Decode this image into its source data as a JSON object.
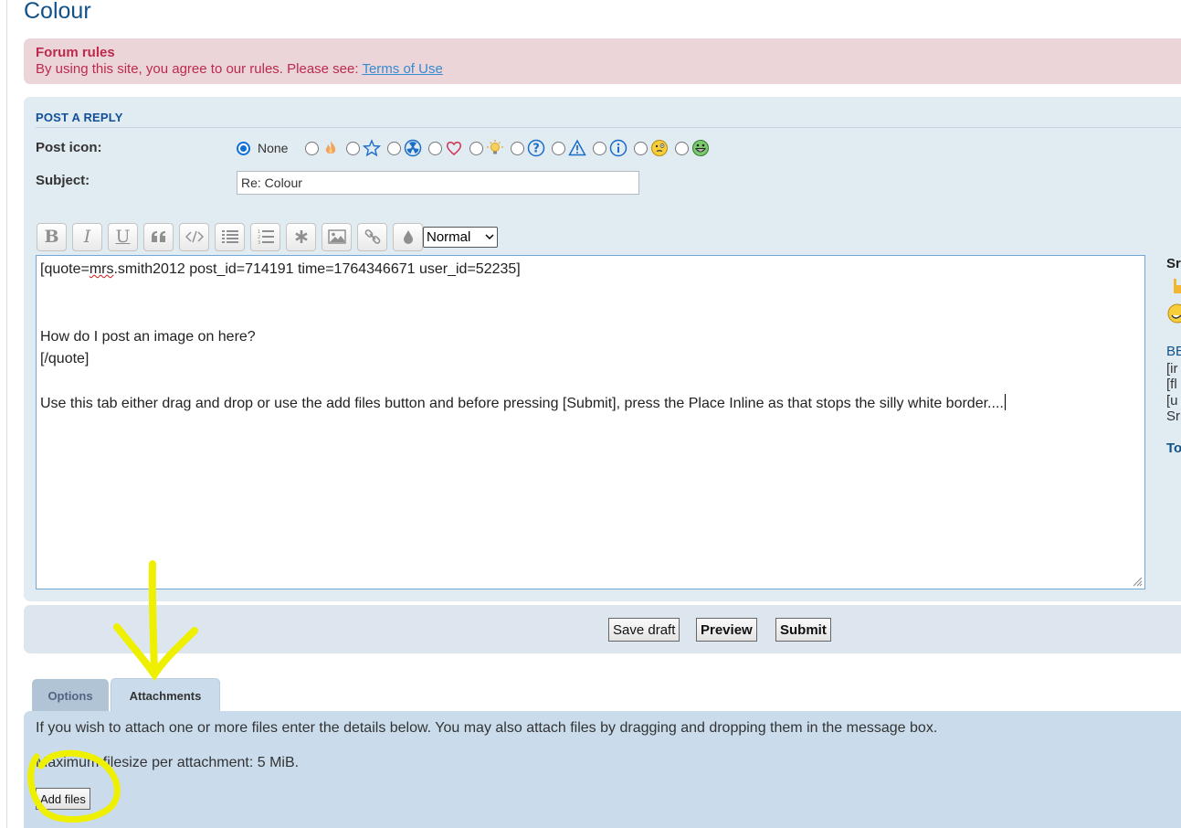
{
  "page": {
    "title": "Colour"
  },
  "forum_rules": {
    "title": "Forum rules",
    "text": "By using this site, you agree to our rules. Please see:",
    "link": "Terms of Use"
  },
  "post_form": {
    "section_title": "POST A REPLY",
    "post_icon_label": "Post icon:",
    "post_icon_none": "None",
    "post_icons": [
      "fire-icon",
      "star-icon",
      "radiation-icon",
      "heart-icon",
      "lightbulb-icon",
      "question-icon",
      "warning-icon",
      "info-icon",
      "thinking-smiley-icon",
      "grin-smiley-icon"
    ],
    "subject_label": "Subject:",
    "subject_value": "Re: Colour",
    "toolbar": {
      "buttons": [
        "bold",
        "italic",
        "underline",
        "quote",
        "code",
        "list",
        "ordered-list",
        "list-item",
        "image",
        "url",
        "colour"
      ],
      "bold_glyph": "B",
      "italic_glyph": "I",
      "underline_glyph": "U",
      "font_size_value": "Normal"
    },
    "message": {
      "line1_pre": "[quote=",
      "line1_sq": "mrs",
      "line1_post": ".smith2012 post_id=714191 time=1764346671 user_id=52235]",
      "line2": "",
      "line3": "",
      "line4": "How do I post an image on here?",
      "line5": "[/quote]",
      "line6": "",
      "line7": "Use this tab either drag and drop or use the add files button and before pressing [Submit], press the Place Inline as that stops the silly white border...."
    }
  },
  "sidebar_fragment": {
    "header": "Sr",
    "link": "BE",
    "items": [
      "[ir",
      "[fl",
      "[u",
      "Sr"
    ],
    "footer": "To"
  },
  "actions": {
    "save_draft": "Save draft",
    "preview": "Preview",
    "submit": "Submit"
  },
  "tabs": {
    "options": "Options",
    "attachments": "Attachments"
  },
  "attachments": {
    "info": "If you wish to attach one or more files enter the details below. You may also attach files by dragging and dropping them in the message box.",
    "max_size": "Maximum filesize per attachment: 5 MiB.",
    "add_files": "Add files"
  },
  "colors": {
    "brand_blue": "#105289",
    "rules_bg": "#ecd5d8",
    "rules_text": "#bc2a4d",
    "panel_bg": "#e1ebf2",
    "attach_bg": "#cadceb",
    "annotation": "#f0f000"
  }
}
